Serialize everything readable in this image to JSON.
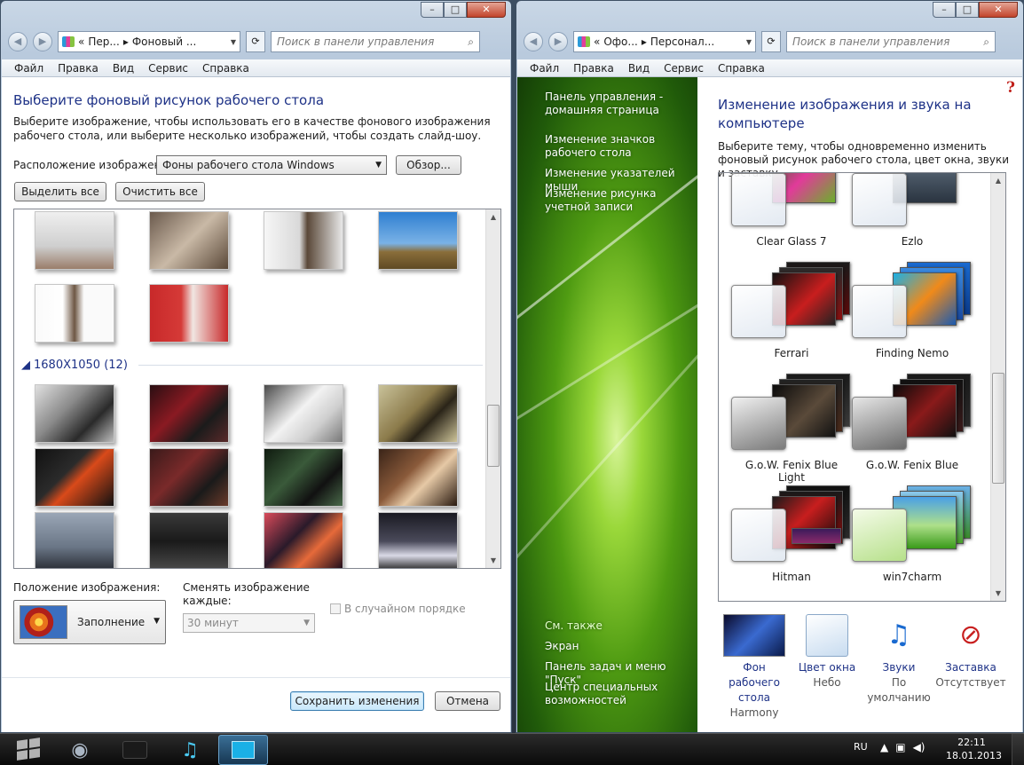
{
  "left_window": {
    "breadcrumb": [
      "Пер...",
      "Фоновый ..."
    ],
    "search_placeholder": "Поиск в панели управления",
    "menu": [
      "Файл",
      "Правка",
      "Вид",
      "Сервис",
      "Справка"
    ],
    "title": "Выберите фоновый рисунок рабочего стола",
    "description": "Выберите изображение, чтобы использовать его в качестве фонового изображения рабочего стола, или выберите несколько изображений, чтобы создать слайд-шоу.",
    "location_label": "Расположение изображения:",
    "location_value": "Фоны рабочего стола Windows",
    "browse_button": "Обзор...",
    "select_all_button": "Выделить все",
    "clear_all_button": "Очистить все",
    "group_label": "1680X1050 (12)",
    "position_label": "Положение изображения:",
    "position_value": "Заполнение",
    "change_label": "Сменять изображение каждые:",
    "interval_value": "30 минут",
    "random_label": "В случайном порядке",
    "save_button": "Сохранить изменения",
    "cancel_button": "Отмена"
  },
  "right_window": {
    "breadcrumb": [
      "Офо...",
      "Персонал..."
    ],
    "search_placeholder": "Поиск в панели управления",
    "menu": [
      "Файл",
      "Правка",
      "Вид",
      "Сервис",
      "Справка"
    ],
    "sidebar": {
      "home": "Панель управления - домашняя страница",
      "links": [
        "Изменение значков рабочего стола",
        "Изменение указателей мыши",
        "Изменение рисунка учетной записи"
      ],
      "see_also": "См. также",
      "see_also_links": [
        "Экран",
        "Панель задач и меню \"Пуск\"",
        "Центр специальных возможностей"
      ]
    },
    "title": "Изменение изображения и звука на компьютере",
    "description": "Выберите тему, чтобы одновременно изменить фоновый рисунок рабочего стола, цвет окна, звуки и заставку.",
    "themes": [
      "Clear Glass 7",
      "Ezlo",
      "Ferrari",
      "Finding Nemo",
      "G.o.W. Fenix Blue Light",
      "G.o.W. Fenix Blue",
      "Hitman",
      "win7charm"
    ],
    "footer_tiles": [
      {
        "title": "Фон рабочего стола",
        "value": "Harmony"
      },
      {
        "title": "Цвет окна",
        "value": "Небо"
      },
      {
        "title": "Звуки",
        "value": "По умолчанию"
      },
      {
        "title": "Заставка",
        "value": "Отсутствует"
      }
    ]
  },
  "taskbar": {
    "language": "RU",
    "time": "22:11",
    "date": "18.01.2013"
  }
}
